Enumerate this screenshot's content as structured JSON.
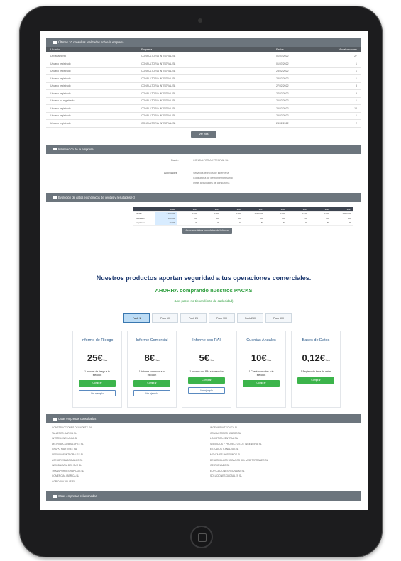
{
  "sections": {
    "last_checks": "Últimas 10 consultas realizadas sobre la empresa",
    "company_info": "Información de la empresa",
    "economic_data": "Evolución de datos económicos de ventas y resultados (€)",
    "other_companies": "Otras empresas consultadas",
    "last_bar": "Otras empresas relacionadas"
  },
  "table": {
    "headers": [
      "Usuario",
      "Empresa",
      "Fecha",
      "Visualizaciones"
    ],
    "rows": [
      [
        "Departamento",
        "CONSULTORIA INTEGRAL SL",
        "01/03/2022",
        "27"
      ],
      [
        "Usuario registrado",
        "CONSULTORIA INTEGRAL SL",
        "01/03/2022",
        "1"
      ],
      [
        "Usuario registrado",
        "CONSULTORIA INTEGRAL SL",
        "28/02/2022",
        "1"
      ],
      [
        "Usuario registrado",
        "CONSULTORIA INTEGRAL SL",
        "28/02/2022",
        "1"
      ],
      [
        "Usuario registrado",
        "CONSULTORIA INTEGRAL SL",
        "27/02/2022",
        "3"
      ],
      [
        "Usuario registrado",
        "CONSULTORIA INTEGRAL SL",
        "27/02/2022",
        "5"
      ],
      [
        "Usuario no registrado",
        "CONSULTORIA INTEGRAL SL",
        "26/02/2022",
        "1"
      ],
      [
        "Usuario registrado",
        "CONSULTORIA INTEGRAL SL",
        "25/02/2022",
        "12"
      ],
      [
        "Usuario registrado",
        "CONSULTORIA INTEGRAL SL",
        "25/02/2022",
        "1"
      ],
      [
        "Usuario registrado",
        "CONSULTORIA INTEGRAL SL",
        "24/02/2022",
        "2"
      ]
    ],
    "more_button": "Ver más"
  },
  "info": {
    "name_label": "Razón",
    "name_value": "CONSULTORIA INTEGRAL SL",
    "activity_label": "Actividades",
    "activity_lines": [
      "Servicios técnicos de ingeniería",
      "Consultoría de gestión empresarial",
      "Otras actividades de consultoría"
    ]
  },
  "mini_table": {
    "headers": [
      "Ventas",
      "2014",
      "2015",
      "2016",
      "2017",
      "2018",
      "2019",
      "2020",
      "2021"
    ],
    "rows": [
      [
        "Ventas",
        "1.100.000",
        "1.200",
        "1.300",
        "1.400",
        "1.500.000",
        "1.600",
        "1.700",
        "1.800",
        "1.900.000"
      ],
      [
        "Resultado",
        "100.000",
        "200",
        "300",
        "400",
        "500",
        "600",
        "700",
        "800",
        "900"
      ],
      [
        "Empleados",
        "10.000",
        "20",
        "30",
        "40",
        "50",
        "60",
        "70",
        "80",
        "90"
      ]
    ],
    "button": "Acceso a datos completos del informe"
  },
  "promo": {
    "title": "Nuestros productos aportan seguridad a tus operaciones comerciales.",
    "subtitle": "AHORRA comprando nuestros PACKS",
    "note": "(Los packs no tienen límite de caducidad)"
  },
  "tabs": [
    "Pack 1",
    "Pack 10",
    "Pack 25",
    "Pack 100",
    "Pack 250",
    "Pack 500"
  ],
  "cards": [
    {
      "title": "Informe de Riesgo",
      "price": "25€",
      "unit": "+iva",
      "desc": "1 Informe de riesgo a tu elección",
      "buy": "Comprar",
      "sample": "Ver ejemplo"
    },
    {
      "title": "Informe Comercial",
      "price": "8€",
      "unit": "+iva",
      "desc": "1 Informe comercial a tu elección",
      "buy": "Comprar",
      "sample": "Ver ejemplo"
    },
    {
      "title": "Informe con RAI",
      "price": "5€",
      "unit": "+iva",
      "desc": "1 Informe con RAI a tu elección",
      "buy": "Comprar",
      "sample": "Ver ejemplo"
    },
    {
      "title": "Cuentas Anuales",
      "price": "10€",
      "unit": "+iva",
      "desc": "1 Cuentas anuales a tu elección",
      "buy": "Comprar",
      "sample": ""
    },
    {
      "title": "Bases de Datos",
      "price": "0,12€",
      "unit": "+iva",
      "desc": "1 Registro de base de datos",
      "buy": "Comprar",
      "sample": ""
    }
  ],
  "other_companies": {
    "left": [
      "CONSTRUCCIONES DEL NORTE SA",
      "TALLERES GARCIA SL",
      "INVERSIONES ALFA SL",
      "DISTRIBUCIONES LOPEZ SL",
      "GRUPO MARTINEZ SA",
      "SERVICIOS INTEGRALES SL",
      "ASESORES ASOCIADOS SL",
      "INMOBILIARIA DEL SUR SL",
      "TRANSPORTES RAPIDOS SL",
      "COMERCIAL IBERICA SL",
      "AGRICOLA VALLE SL"
    ],
    "right": [
      "INGENIERIA TECNICA SL",
      "CONSULTORES UNIDOS SL",
      "LOGISTICA CENTRAL SA",
      "SERVICIOS Y PROYECTOS DE INGENIERIA SL",
      "ESTUDIOS Y ANALISIS SL",
      "MONTAJES MODERNOS SL",
      "DESARROLLOS URBANOS DEL MEDITERRANEO SL",
      "GESTION ABC SL",
      "EDIFICACIONES REUNIDAS SL",
      "SOLUCIONES GLOBALES SL"
    ]
  }
}
